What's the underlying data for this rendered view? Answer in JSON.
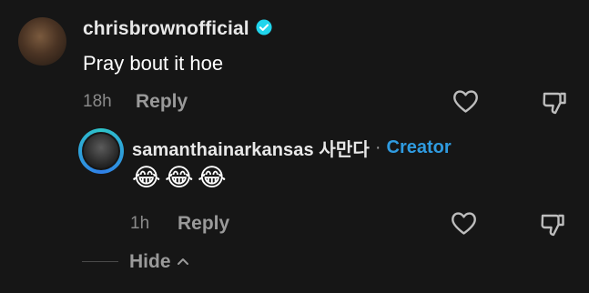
{
  "comment": {
    "username": "chrisbrownofficial",
    "text": "Pray bout it hoe",
    "time": "18h",
    "reply_label": "Reply"
  },
  "reply": {
    "username": "samanthainarkansas 사만다",
    "separator": "·",
    "badge": "Creator",
    "emoji": [
      "😂",
      "😂",
      "😂"
    ],
    "time": "1h",
    "reply_label": "Reply"
  },
  "thread": {
    "hide_label": "Hide"
  },
  "colors": {
    "background": "#161616",
    "creator": "#2f9be0",
    "verified": "#20d5ec"
  },
  "icons": [
    "verified-icon",
    "heart-icon",
    "dislike-icon",
    "chevron-up-icon"
  ]
}
